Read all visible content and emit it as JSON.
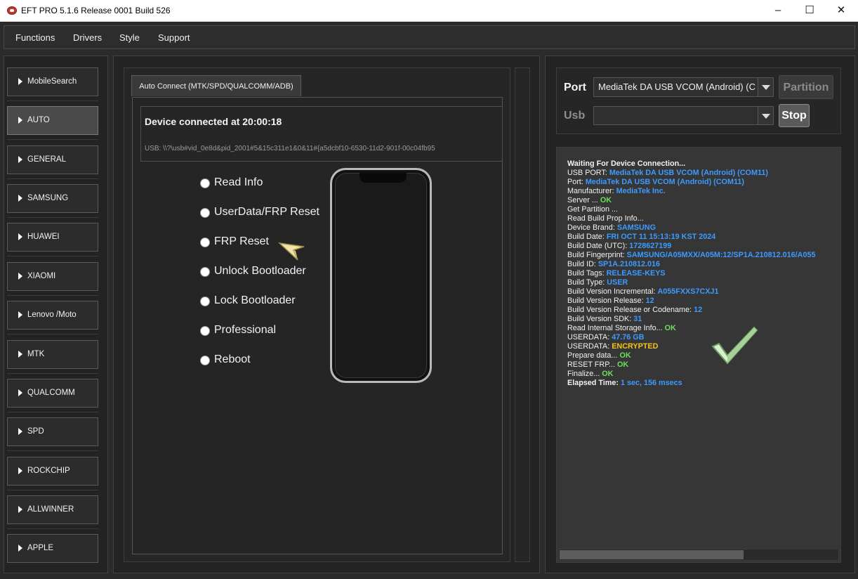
{
  "window": {
    "title": "EFT PRO 5.1.6 Release 0001 Build 526"
  },
  "menu": [
    "Functions",
    "Drivers",
    "Style",
    "Support"
  ],
  "sidebar": {
    "items": [
      {
        "label": "MobileSearch",
        "active": false
      },
      {
        "label": "AUTO",
        "active": true
      },
      {
        "label": "GENERAL",
        "active": false
      },
      {
        "label": "SAMSUNG",
        "active": false
      },
      {
        "label": "HUAWEI",
        "active": false
      },
      {
        "label": "XIAOMI",
        "active": false
      },
      {
        "label": "Lenovo /Moto",
        "active": false
      },
      {
        "label": "MTK",
        "active": false
      },
      {
        "label": "QUALCOMM",
        "active": false
      },
      {
        "label": "SPD",
        "active": false
      },
      {
        "label": "ROCKCHIP",
        "active": false
      },
      {
        "label": "ALLWINNER",
        "active": false
      },
      {
        "label": "APPLE",
        "active": false
      }
    ]
  },
  "center": {
    "tab_label": "Auto Connect (MTK/SPD/QUALCOMM/ADB)",
    "device_title": "Device connected at 20:00:18",
    "device_usb": "USB: \\\\?\\usb#vid_0e8d&pid_2001#5&15c311e1&0&11#{a5dcbf10-6530-11d2-901f-00c04fb95",
    "options": [
      "Read Info",
      "UserData/FRP Reset",
      "FRP Reset",
      "Unlock Bootloader",
      "Lock Bootloader",
      "Professional",
      "Reboot"
    ]
  },
  "port_panel": {
    "port_label": "Port",
    "port_value": "MediaTek DA USB VCOM (Android) (C",
    "usb_label": "Usb",
    "usb_value": "",
    "partition_button": "Partition",
    "stop_button": "Stop"
  },
  "log": [
    {
      "label": "Waiting For Device Connection...",
      "value": "",
      "color": "",
      "bold_label": true
    },
    {
      "label": "USB PORT: ",
      "value": "MediaTek DA USB VCOM (Android) (COM11)",
      "color": "#3d9bff"
    },
    {
      "label": "Port: ",
      "value": "MediaTek DA USB VCOM (Android) (COM11)",
      "color": "#3d9bff"
    },
    {
      "label": "Manufacturer: ",
      "value": "MediaTek Inc.",
      "color": "#3d9bff"
    },
    {
      "label": "Server ... ",
      "value": "OK",
      "color": "#6ddf5a"
    },
    {
      "label": "Get Partition ...",
      "value": "",
      "color": ""
    },
    {
      "label": "Read Build Prop Info...",
      "value": "",
      "color": ""
    },
    {
      "label": " Device Brand: ",
      "value": "SAMSUNG",
      "color": "#3d9bff"
    },
    {
      "label": " Build Date: ",
      "value": "FRI OCT 11 15:13:19 KST 2024",
      "color": "#3d9bff"
    },
    {
      "label": " Build Date (UTC): ",
      "value": "1728627199",
      "color": "#3d9bff"
    },
    {
      "label": " Build Fingerprint: ",
      "value": "SAMSUNG/A05MXX/A05M:12/SP1A.210812.016/A055",
      "color": "#3d9bff"
    },
    {
      "label": " Build ID: ",
      "value": "SP1A.210812.016",
      "color": "#3d9bff"
    },
    {
      "label": " Build Tags: ",
      "value": "RELEASE-KEYS",
      "color": "#3d9bff"
    },
    {
      "label": " Build Type: ",
      "value": "USER",
      "color": "#3d9bff"
    },
    {
      "label": " Build Version Incremental: ",
      "value": "A055FXXS7CXJ1",
      "color": "#3d9bff"
    },
    {
      "label": " Build Version Release: ",
      "value": "12",
      "color": "#3d9bff"
    },
    {
      "label": " Build Version Release or Codename: ",
      "value": "12",
      "color": "#3d9bff"
    },
    {
      "label": " Build Version SDK: ",
      "value": "31",
      "color": "#3d9bff"
    },
    {
      "label": "Read Internal Storage Info... ",
      "value": "OK",
      "color": "#6ddf5a"
    },
    {
      "label": "USERDATA: ",
      "value": "47.76 GB",
      "color": "#3d9bff"
    },
    {
      "label": "USERDATA: ",
      "value": "ENCRYPTED",
      "color": "#f5c518"
    },
    {
      "label": "Prepare data... ",
      "value": "OK",
      "color": "#6ddf5a"
    },
    {
      "label": "RESET FRP... ",
      "value": "OK",
      "color": "#6ddf5a"
    },
    {
      "label": "Finalize... ",
      "value": "OK",
      "color": "#6ddf5a"
    },
    {
      "label": "Elapsed Time: ",
      "value": "1 sec, 156 msecs",
      "color": "#3d9bff",
      "bold_label": true
    }
  ],
  "log_scrollbar_position": 0.65,
  "colors": {
    "accent_blue": "#3d9bff",
    "ok_green": "#6ddf5a",
    "warn_yellow": "#f5c518",
    "panel_bg": "#232323"
  }
}
